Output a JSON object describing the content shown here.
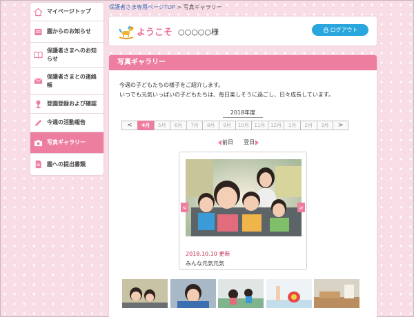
{
  "sidebar": {
    "items": [
      {
        "label": "マイページトップ",
        "icon": "house-icon"
      },
      {
        "label": "園からのお知らせ",
        "icon": "notice-icon"
      },
      {
        "label": "保護者さまへのお知らせ",
        "icon": "book-icon"
      },
      {
        "label": "保護者さまとの連絡帳",
        "icon": "envelope-icon"
      },
      {
        "label": "登園登録および確認",
        "icon": "pin-icon"
      },
      {
        "label": "今週の活動報告",
        "icon": "pencil-icon"
      },
      {
        "label": "写真ギャラリー",
        "icon": "camera-icon",
        "active": true
      },
      {
        "label": "園への提出書類",
        "icon": "document-icon"
      }
    ]
  },
  "breadcrumb": {
    "link": "保護者さま専用ページTOP",
    "separator": ">",
    "current": "写真ギャラリー"
  },
  "header": {
    "welcome": "ようこそ",
    "username": "○○○○○様",
    "logout_label": "ログアウト"
  },
  "gallery": {
    "title": "写真ギャラリー",
    "intro_line1": "今週の子どもたちの様子をご紹介します。",
    "intro_line2": "いつでも元気いっぱいの子どもたちは、毎日楽しそうに過ごし、日々成長しています。",
    "year_label": "2018年度",
    "months": [
      "4月",
      "5月",
      "6月",
      "7月",
      "8月",
      "9月",
      "10月",
      "11月",
      "12月",
      "1月",
      "2月",
      "3月"
    ],
    "active_month": "4月",
    "prev_arrow": "<",
    "next_arrow": ">",
    "prev_day": "前日",
    "next_day": "翌日",
    "photo_date": "2018.10.10 更新",
    "photo_caption": "みんな元気元気"
  },
  "colors": {
    "accent_pink": "#ee7ea0",
    "logout_blue": "#2aa6de",
    "date_red": "#c0294c",
    "link_blue": "#3a6fb5"
  }
}
